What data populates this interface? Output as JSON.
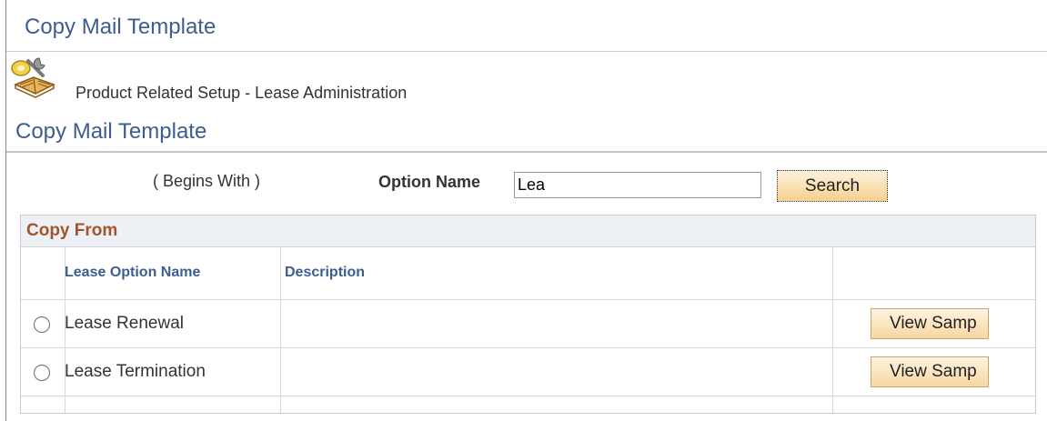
{
  "page": {
    "title": "Copy Mail Template"
  },
  "breadcrumb": {
    "text": "Product Related Setup - Lease Administration",
    "icon": "setup-book-wrench-icon"
  },
  "section": {
    "title": "Copy Mail Template"
  },
  "search": {
    "qualifier": "( Begins With )",
    "label": "Option Name",
    "value": "Lea",
    "button_label": "Search"
  },
  "grid": {
    "title": "Copy From",
    "columns": [
      "Lease Option Name",
      "Description",
      ""
    ],
    "rows": [
      {
        "name": "Lease Renewal",
        "description": "",
        "action_label": "View Samp",
        "selected": false
      },
      {
        "name": "Lease Termination",
        "description": "",
        "action_label": "View Samp",
        "selected": false
      }
    ]
  },
  "colors": {
    "title_blue": "#3d5d91",
    "grid_title": "#a4542c",
    "button_fill": "#f7d18f"
  }
}
